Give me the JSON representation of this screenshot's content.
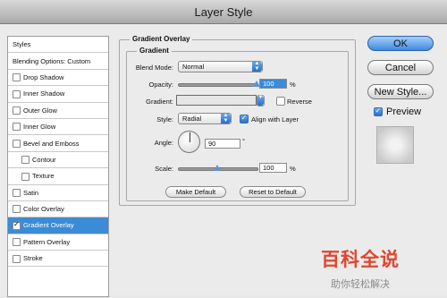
{
  "window": {
    "title": "Layer Style"
  },
  "styles_list": [
    {
      "label": "Styles",
      "kind": "head"
    },
    {
      "label": "Blending Options: Custom",
      "kind": "head"
    },
    {
      "label": "Drop Shadow",
      "checked": false
    },
    {
      "label": "Inner Shadow",
      "checked": false
    },
    {
      "label": "Outer Glow",
      "checked": false
    },
    {
      "label": "Inner Glow",
      "checked": false
    },
    {
      "label": "Bevel and Emboss",
      "checked": false
    },
    {
      "label": "Contour",
      "checked": false,
      "sub": true
    },
    {
      "label": "Texture",
      "checked": false,
      "sub": true
    },
    {
      "label": "Satin",
      "checked": false
    },
    {
      "label": "Color Overlay",
      "checked": false
    },
    {
      "label": "Gradient Overlay",
      "checked": true,
      "selected": true
    },
    {
      "label": "Pattern Overlay",
      "checked": false
    },
    {
      "label": "Stroke",
      "checked": false
    }
  ],
  "panel": {
    "title": "Gradient Overlay",
    "group_title": "Gradient",
    "blend_mode": {
      "label": "Blend Mode:",
      "value": "Normal"
    },
    "opacity": {
      "label": "Opacity:",
      "value": "100",
      "unit": "%",
      "level": 1.0
    },
    "gradient": {
      "label": "Gradient:",
      "reverse_label": "Reverse",
      "reverse": false
    },
    "style": {
      "label": "Style:",
      "value": "Radial",
      "align_label": "Align with Layer",
      "align": true
    },
    "angle": {
      "label": "Angle:",
      "value": "90",
      "unit": "°"
    },
    "scale": {
      "label": "Scale:",
      "value": "100",
      "unit": "%",
      "level": 0.5
    },
    "make_default": "Make Default",
    "reset_default": "Reset to Default"
  },
  "buttons": {
    "ok": "OK",
    "cancel": "Cancel",
    "new_style": "New Style...",
    "preview_label": "Preview",
    "preview_checked": true
  },
  "watermark": {
    "title": "百科全说",
    "subtitle": "助你轻松解决"
  },
  "colors": {
    "selection": "#3b8bd6",
    "accent": "#2d6fc1",
    "watermark_red": "#e0452d"
  }
}
